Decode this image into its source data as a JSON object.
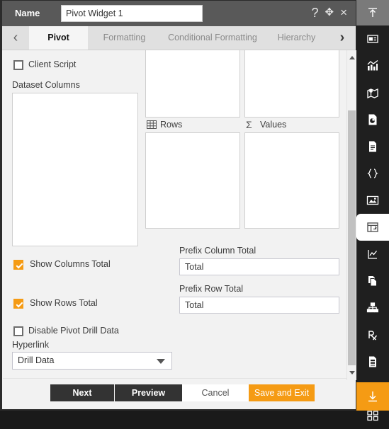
{
  "titlebar": {
    "name_label": "Name",
    "name_value": "Pivot Widget 1",
    "help_icon": "?",
    "move_icon": "✥",
    "close_icon": "×"
  },
  "tabs": {
    "prev_arrow": "‹",
    "next_arrow": "›",
    "items": [
      {
        "label": "Pivot",
        "active": true
      },
      {
        "label": "Formatting",
        "active": false
      },
      {
        "label": "Conditional Formatting",
        "active": false
      },
      {
        "label": "Hierarchy",
        "active": false
      }
    ]
  },
  "form": {
    "client_script_label": "Client Script",
    "client_script_checked": false,
    "dataset_columns_label": "Dataset Columns",
    "rows_label": "Rows",
    "rows_icon": "table-icon",
    "values_label": "Values",
    "values_icon": "sigma-icon",
    "show_columns_total_label": "Show Columns Total",
    "show_columns_total_checked": true,
    "show_rows_total_label": "Show Rows Total",
    "show_rows_total_checked": true,
    "disable_drill_label": "Disable Pivot Drill Data",
    "disable_drill_checked": false,
    "prefix_column_total_label": "Prefix Column Total",
    "prefix_column_total_value": "Total",
    "prefix_row_total_label": "Prefix Row Total",
    "prefix_row_total_value": "Total",
    "hyperlink_label": "Hyperlink",
    "hyperlink_value": "Drill Data"
  },
  "footer": {
    "next": "Next",
    "preview": "Preview",
    "cancel": "Cancel",
    "save_and_exit": "Save and Exit"
  },
  "rail": {
    "items": [
      {
        "name": "collapse-up-icon",
        "state": "top"
      },
      {
        "name": "panel-icon",
        "state": "normal"
      },
      {
        "name": "chart-icon",
        "state": "normal"
      },
      {
        "name": "map-icon",
        "state": "normal"
      },
      {
        "name": "report-icon",
        "state": "normal"
      },
      {
        "name": "document-icon",
        "state": "normal"
      },
      {
        "name": "code-braces-icon",
        "state": "normal"
      },
      {
        "name": "image-icon",
        "state": "normal"
      },
      {
        "name": "pivot-widget-icon",
        "state": "active"
      },
      {
        "name": "line-chart-icon",
        "state": "normal"
      },
      {
        "name": "copy-icon",
        "state": "normal"
      },
      {
        "name": "hierarchy-icon",
        "state": "normal"
      },
      {
        "name": "prescription-icon",
        "state": "normal"
      },
      {
        "name": "form-icon",
        "state": "normal"
      },
      {
        "name": "layers-icon",
        "state": "normal"
      },
      {
        "name": "grid-icon",
        "state": "normal"
      },
      {
        "name": "download-icon",
        "state": "bottom"
      }
    ]
  },
  "colors": {
    "accent": "#f59b14",
    "titlebar": "#595959",
    "rail": "#1f1f1f",
    "dark_button": "#333333"
  }
}
